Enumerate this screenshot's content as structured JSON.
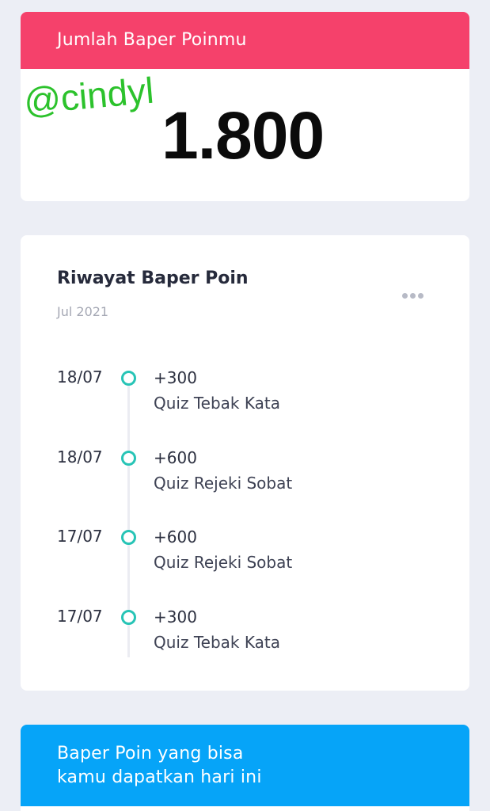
{
  "points_card": {
    "header": "Jumlah Baper Poinmu",
    "username": "@cindyl",
    "total": "1.800"
  },
  "history_card": {
    "title": "Riwayat Baper Poin",
    "month": "Jul 2021",
    "more_icon": "more-horizontal-icon",
    "items": [
      {
        "date": "18/07",
        "points": "+300",
        "desc": "Quiz Tebak Kata"
      },
      {
        "date": "18/07",
        "points": "+600",
        "desc": "Quiz Rejeki Sobat"
      },
      {
        "date": "17/07",
        "points": "+600",
        "desc": "Quiz Rejeki Sobat"
      },
      {
        "date": "17/07",
        "points": "+300",
        "desc": "Quiz Tebak Kata"
      }
    ]
  },
  "earn_card": {
    "header_line1": "Baper Poin yang bisa",
    "header_line2": "kamu dapatkan hari ini"
  },
  "colors": {
    "points_header": "#f5416b",
    "earn_header": "#06a4f8",
    "timeline_marker": "#27c4b6",
    "username": "#2cc22c",
    "background": "#eceef5"
  }
}
